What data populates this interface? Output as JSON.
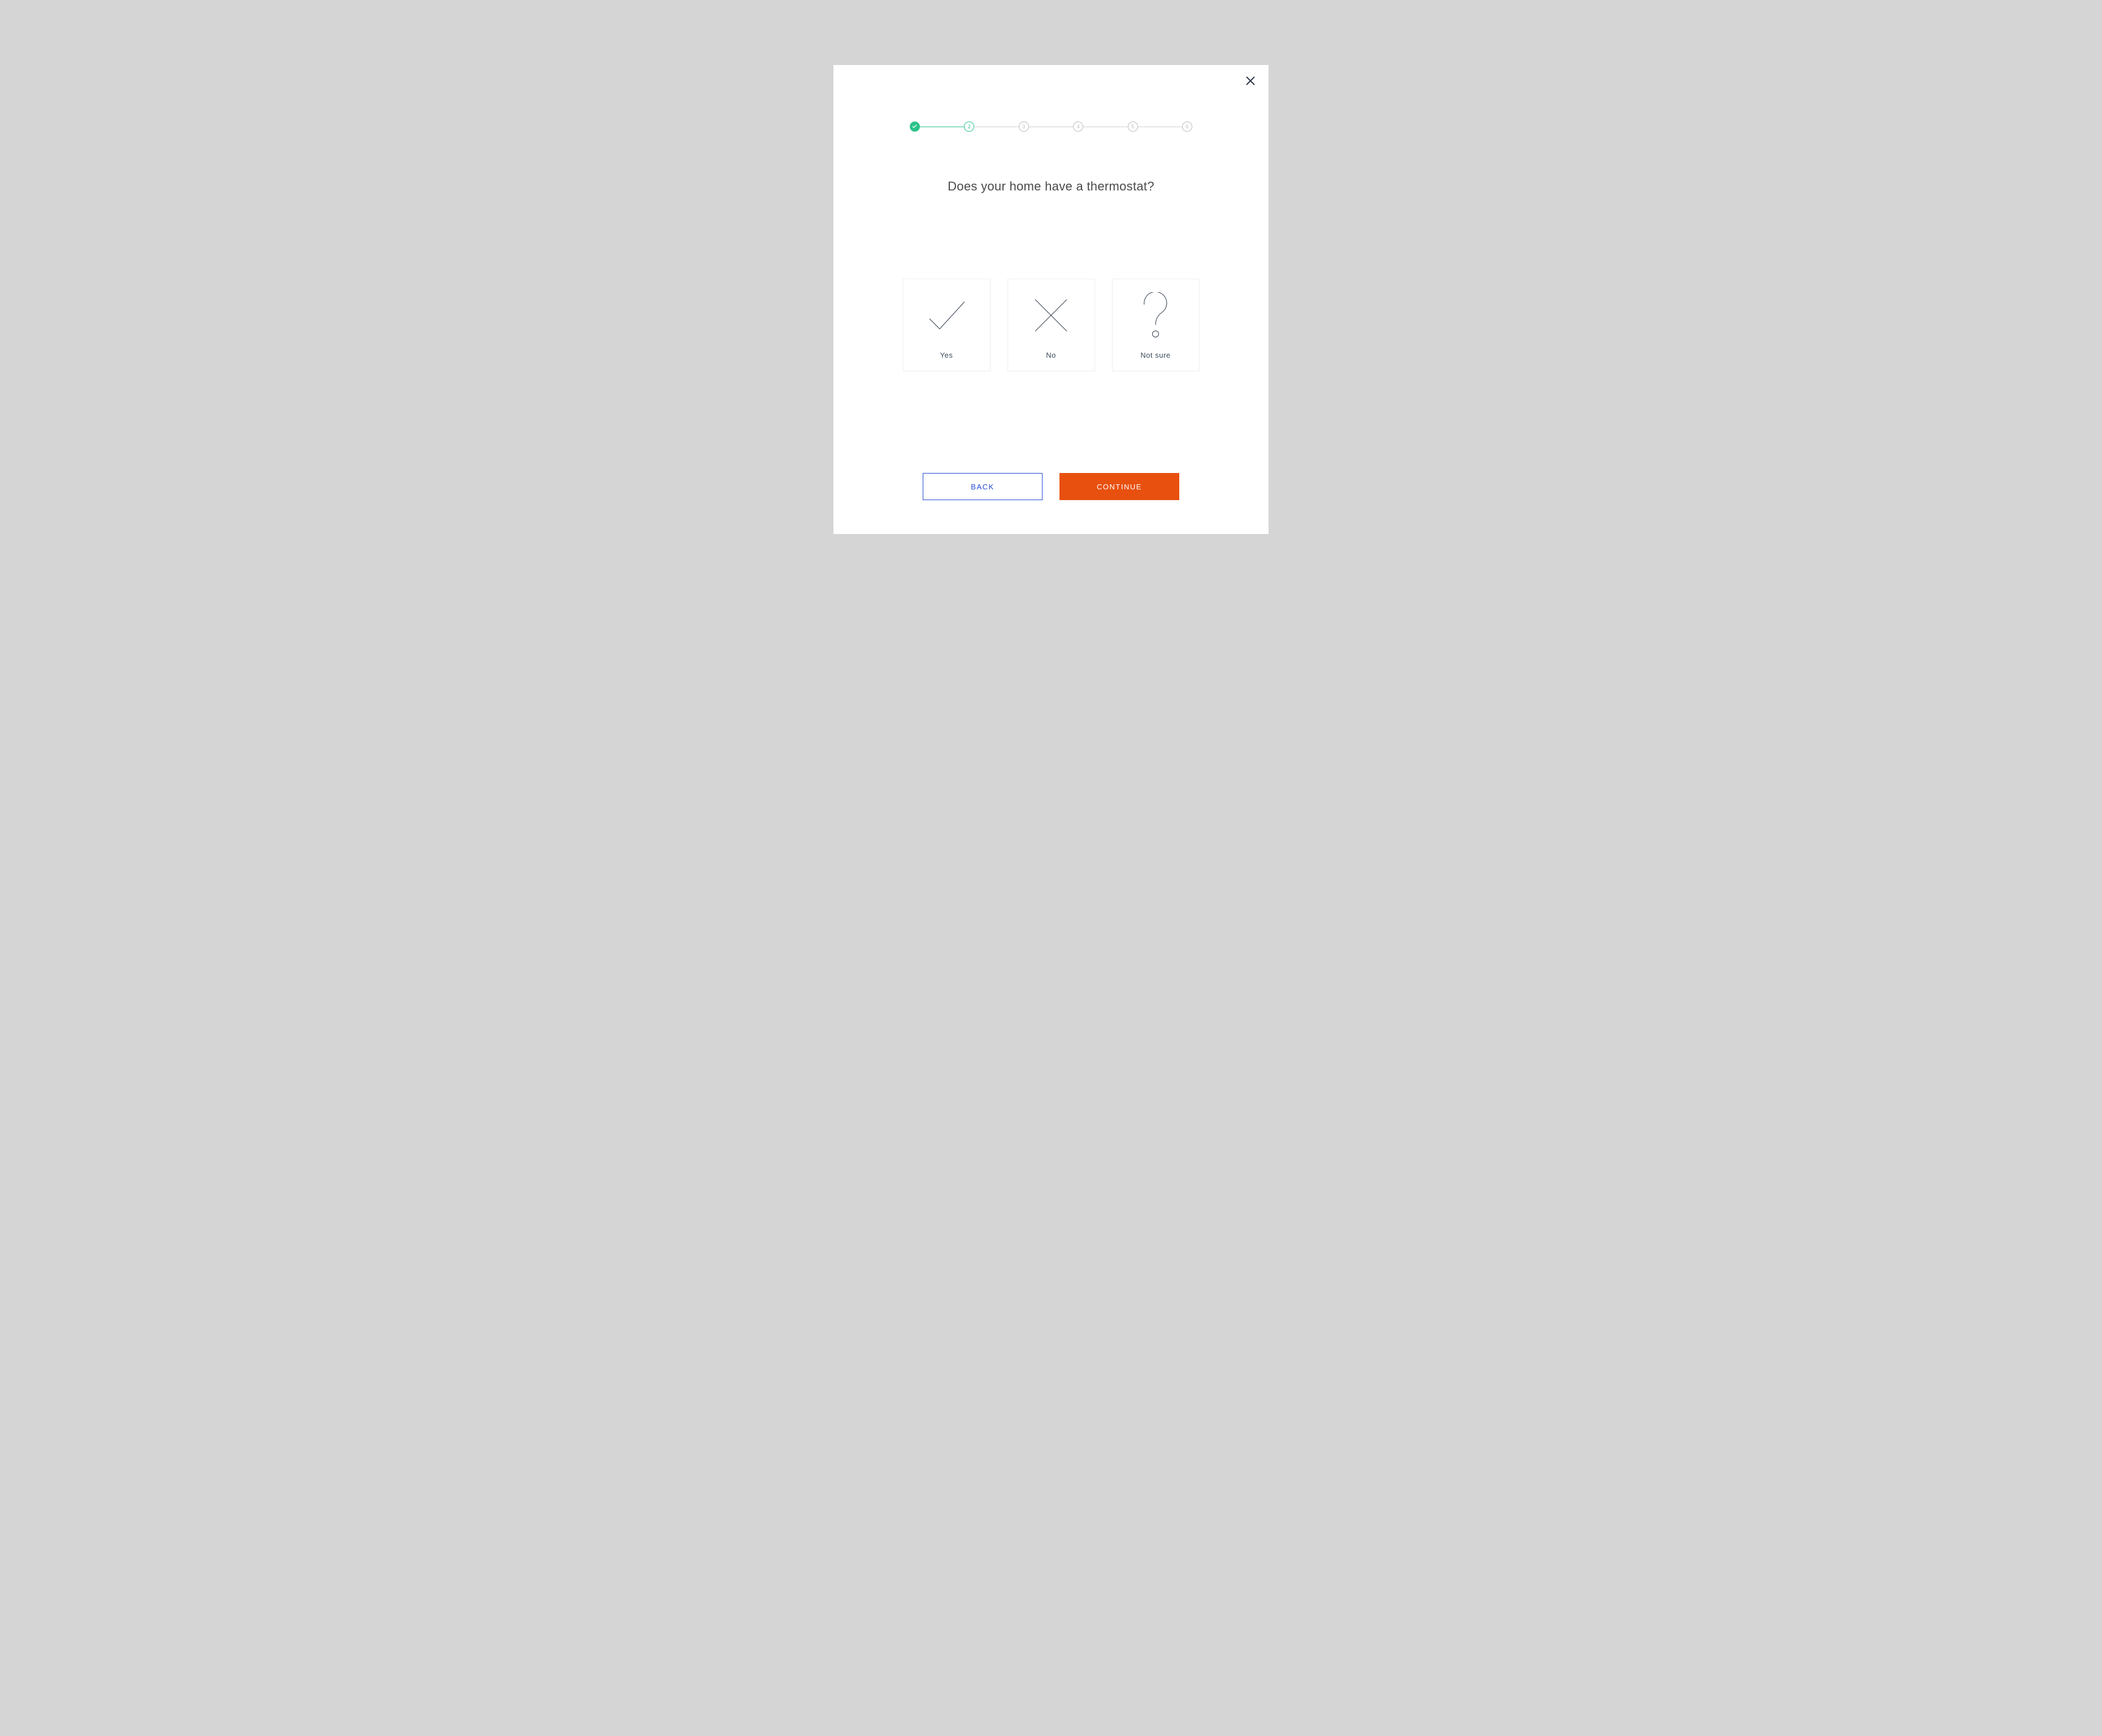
{
  "stepper": {
    "steps": [
      {
        "label": "",
        "state": "done"
      },
      {
        "label": "2",
        "state": "active"
      },
      {
        "label": "3",
        "state": "upcoming"
      },
      {
        "label": "4",
        "state": "upcoming"
      },
      {
        "label": "5",
        "state": "upcoming"
      },
      {
        "label": "6",
        "state": "upcoming"
      }
    ]
  },
  "question": "Does your home have a thermostat?",
  "options": {
    "yes": "Yes",
    "no": "No",
    "not_sure": "Not sure"
  },
  "buttons": {
    "back": "BACK",
    "continue": "CONTINUE"
  }
}
